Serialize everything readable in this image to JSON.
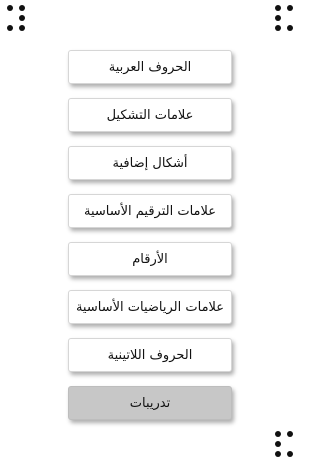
{
  "menu": {
    "items": [
      {
        "label": "الحروف العربية"
      },
      {
        "label": "علامات التشكيل"
      },
      {
        "label": "أشكال إضافية"
      },
      {
        "label": "علامات الترقيم الأساسية"
      },
      {
        "label": "الأرقام"
      },
      {
        "label": "علامات الرياضيات الأساسية"
      },
      {
        "label": "الحروف اللاتينية"
      },
      {
        "label": "تدريبات"
      }
    ],
    "selected_index": 7
  },
  "colors": {
    "button_background": "#ffffff",
    "button_selected_background": "#c7c7c7",
    "dot_color": "#111111"
  },
  "icons": {
    "corner_top_left": "braille-cell-icon",
    "corner_top_right": "braille-cell-icon",
    "corner_bottom_right": "braille-cell-icon"
  }
}
